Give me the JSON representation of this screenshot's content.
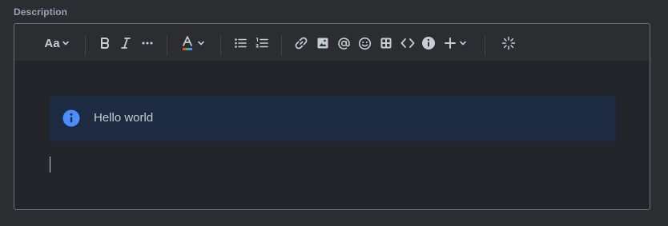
{
  "field": {
    "label": "Description"
  },
  "toolbar": {
    "text_style_label": "Aa",
    "buttons": [
      {
        "name": "text-style",
        "icon": "text-style-icon"
      },
      {
        "name": "bold",
        "icon": "bold-icon"
      },
      {
        "name": "italic",
        "icon": "italic-icon"
      },
      {
        "name": "more-formatting",
        "icon": "more-icon"
      },
      {
        "name": "text-color",
        "icon": "text-color-icon"
      },
      {
        "name": "bullet-list",
        "icon": "bullet-list-icon"
      },
      {
        "name": "numbered-list",
        "icon": "numbered-list-icon"
      },
      {
        "name": "link",
        "icon": "link-icon"
      },
      {
        "name": "image",
        "icon": "image-icon"
      },
      {
        "name": "mention",
        "icon": "mention-icon"
      },
      {
        "name": "emoji",
        "icon": "emoji-icon"
      },
      {
        "name": "table",
        "icon": "table-icon"
      },
      {
        "name": "code",
        "icon": "code-icon"
      },
      {
        "name": "info-panel",
        "icon": "info-icon"
      },
      {
        "name": "insert-more",
        "icon": "plus-icon"
      },
      {
        "name": "ai-assist",
        "icon": "sparkle-icon"
      }
    ]
  },
  "content": {
    "info_panel_text": "Hello world"
  },
  "colors": {
    "background": "#2b2d31",
    "editor_background": "#22252a",
    "info_panel_background": "#1c2b41",
    "info_icon": "#4c8dff",
    "icon_color": "#c7cdd5",
    "label_color": "#9aa4b1"
  }
}
